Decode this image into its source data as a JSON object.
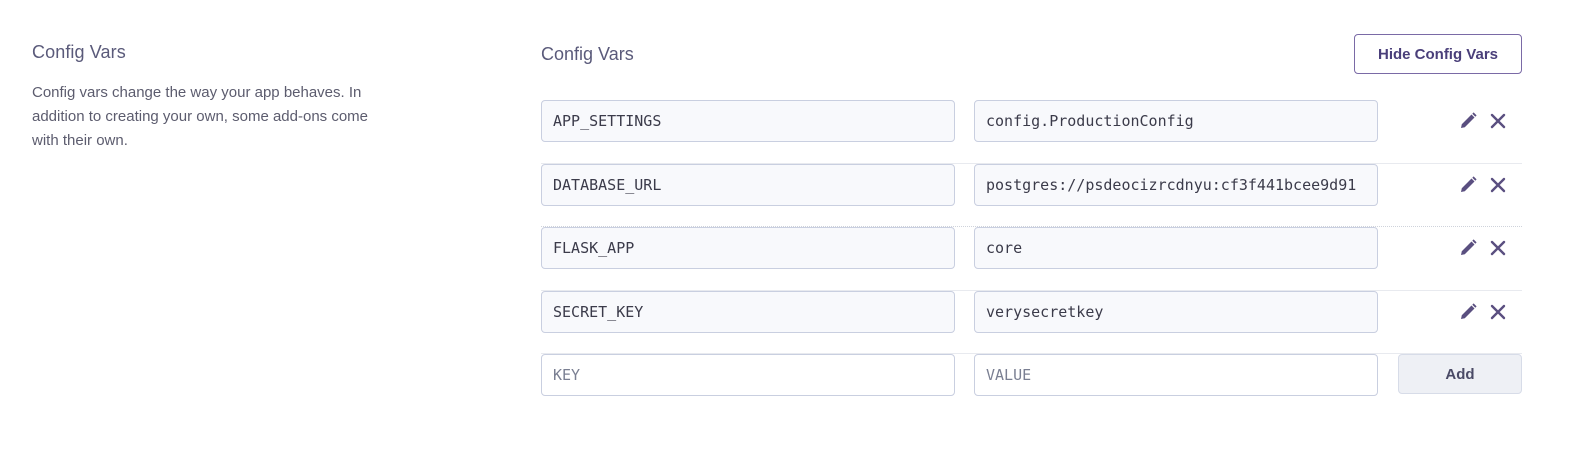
{
  "sidebar": {
    "title": "Config Vars",
    "description": "Config vars change the way your app behaves. In addition to creating your own, some add-ons come with their own."
  },
  "main": {
    "title": "Config Vars",
    "hide_button_label": "Hide Config Vars",
    "vars": [
      {
        "key": "APP_SETTINGS",
        "value": "config.ProductionConfig"
      },
      {
        "key": "DATABASE_URL",
        "value": "postgres://psdeocizrcdnyu:cf3f441bcee9d91"
      },
      {
        "key": "FLASK_APP",
        "value": "core"
      },
      {
        "key": "SECRET_KEY",
        "value": "verysecretkey"
      }
    ],
    "new_var": {
      "key_placeholder": "KEY",
      "value_placeholder": "VALUE",
      "add_label": "Add"
    },
    "row_icons": [
      "pencil-icon",
      "close-icon"
    ]
  },
  "colors": {
    "accent": "#4a3f7a",
    "title": "#5a5a7a",
    "field_border": "#c9cfe0",
    "field_bg": "#f8f9fc"
  }
}
